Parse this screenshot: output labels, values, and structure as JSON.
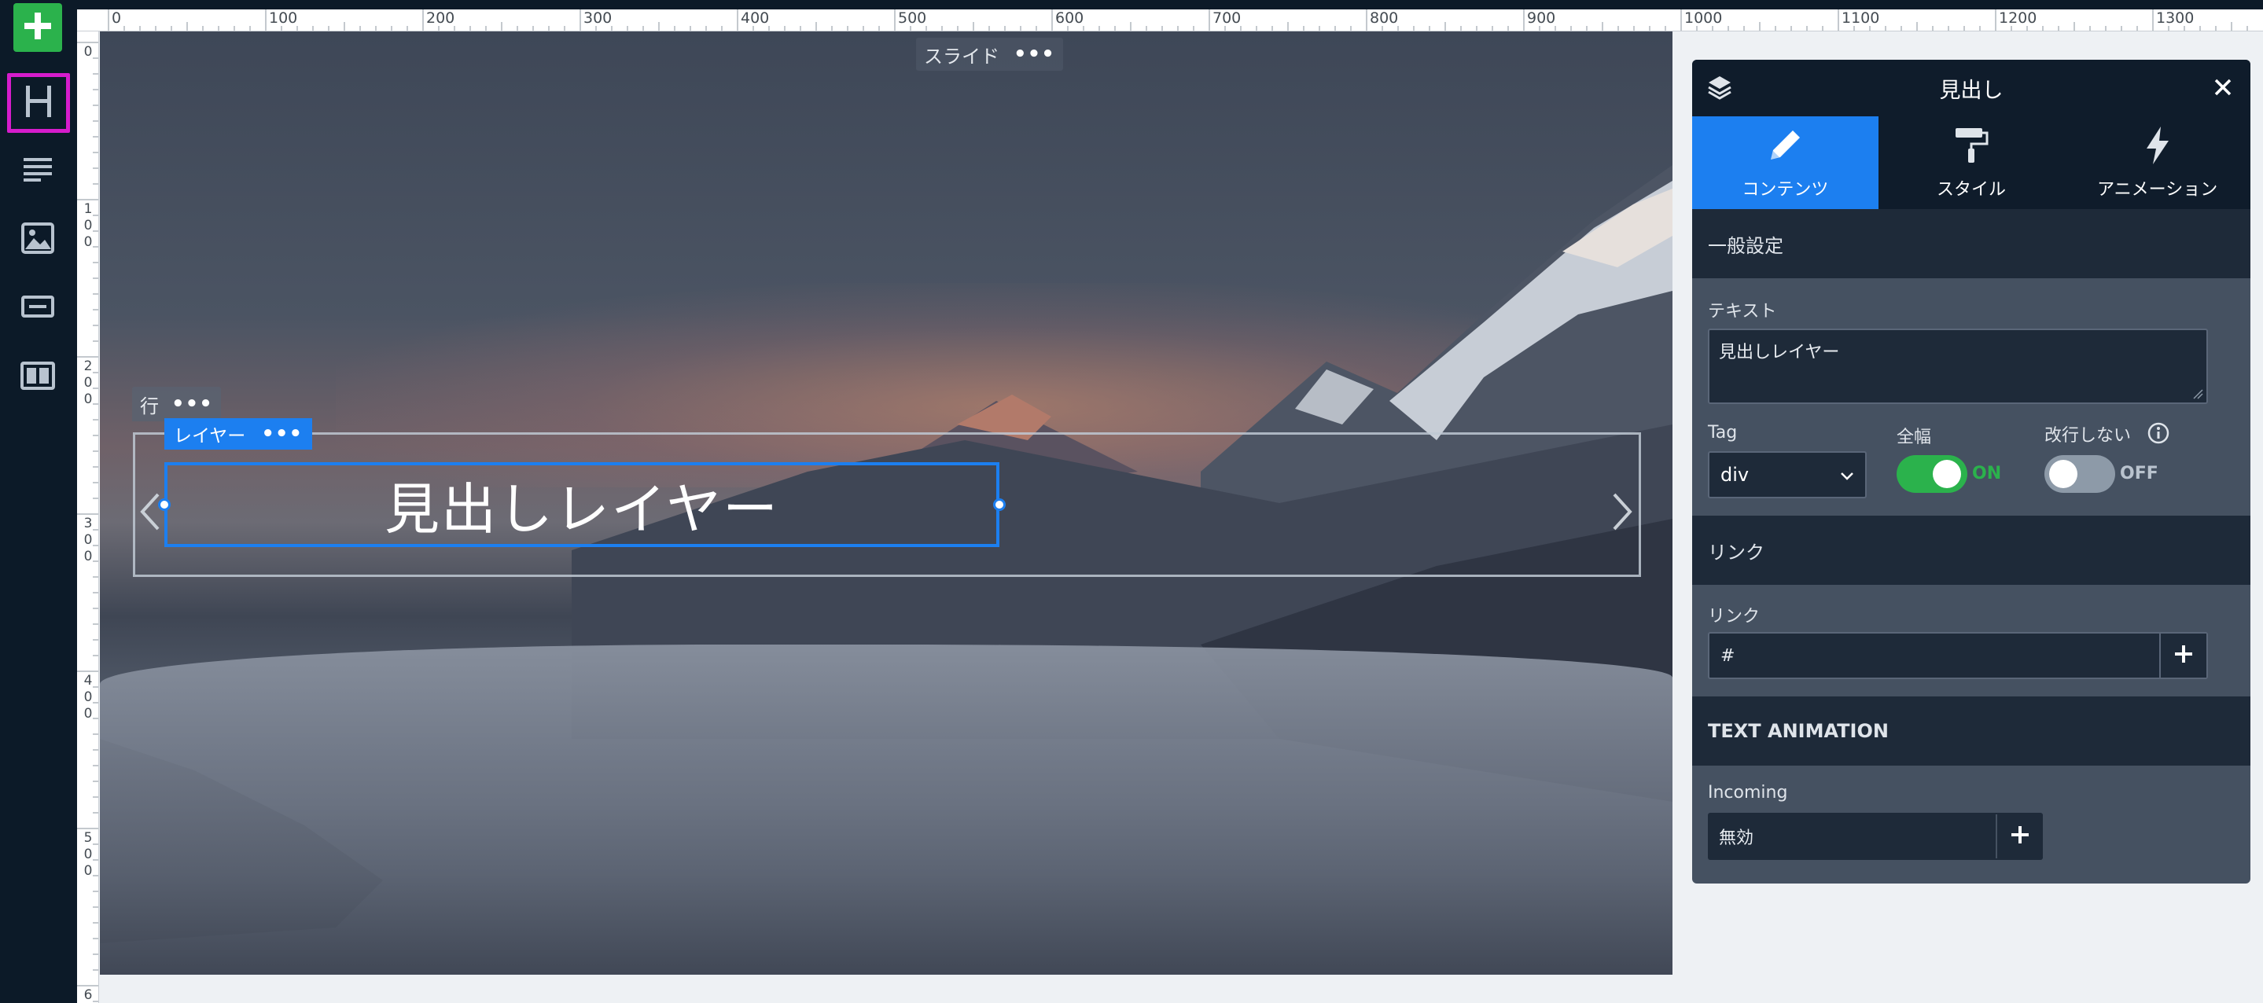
{
  "toolbar": {
    "items": [
      {
        "name": "add",
        "icon": "plus-icon"
      },
      {
        "name": "heading",
        "icon": "heading-icon"
      },
      {
        "name": "text",
        "icon": "text-icon"
      },
      {
        "name": "image",
        "icon": "image-icon"
      },
      {
        "name": "button",
        "icon": "button-icon"
      },
      {
        "name": "row",
        "icon": "row-icon"
      }
    ],
    "add_color": "#2bb24c",
    "highlight_color": "#d61ccc"
  },
  "ruler": {
    "top_labels": [
      "0",
      "100",
      "200",
      "300",
      "400",
      "500",
      "600",
      "700",
      "800",
      "900",
      "1000",
      "1100",
      "1200",
      "1300"
    ],
    "left_labels": [
      "0",
      "100",
      "200",
      "300",
      "400",
      "500",
      "6"
    ]
  },
  "canvas": {
    "slide_label": "スライド",
    "slide_menu": "•••",
    "row_label": "行",
    "row_menu": "•••",
    "layer_label": "レイヤー",
    "layer_menu": "•••",
    "heading_text": "見出しレイヤー",
    "accent_color": "#1c7ff0"
  },
  "panel": {
    "title": "見出し",
    "tabs": [
      {
        "label": "コンテンツ",
        "icon": "pencil-icon",
        "active": true
      },
      {
        "label": "スタイル",
        "icon": "paint-roller-icon",
        "active": false
      },
      {
        "label": "アニメーション",
        "icon": "lightning-icon",
        "active": false
      }
    ],
    "general": {
      "section_title": "一般設定",
      "text_label": "テキスト",
      "text_value": "見出しレイヤー",
      "tag_label": "Tag",
      "tag_value": "div",
      "fullwidth_label": "全幅",
      "fullwidth_state": "ON",
      "nowrap_label": "改行しない",
      "nowrap_state": "OFF"
    },
    "link": {
      "section_title": "リンク",
      "link_label": "リンク",
      "link_value": "#"
    },
    "animation": {
      "section_title": "TEXT ANIMATION",
      "incoming_label": "Incoming",
      "incoming_value": "無効"
    },
    "colors": {
      "on_green": "#2bb24c",
      "off_gray": "#8d9aa8"
    }
  }
}
